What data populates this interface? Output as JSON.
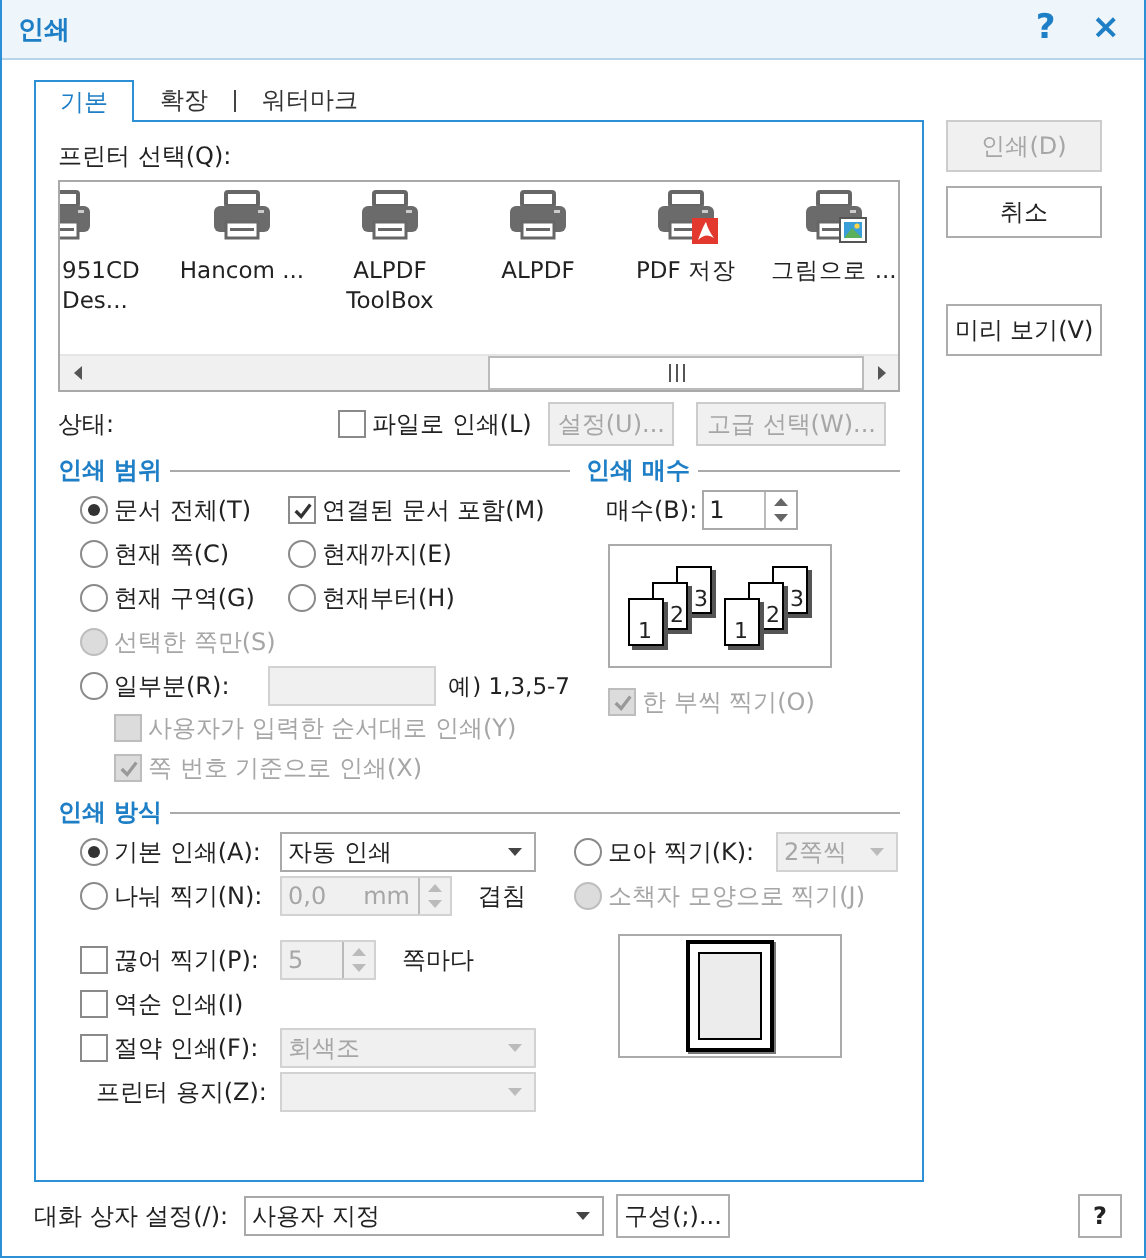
{
  "window": {
    "title": "인쇄",
    "help": "?",
    "close": "×"
  },
  "tabs": [
    {
      "label": "기본",
      "selected": true
    },
    {
      "label": "확장",
      "selected": false
    },
    {
      "label": "워터마크",
      "selected": false
    }
  ],
  "printer_select": {
    "label": "프린터 선택(Q):",
    "printers": [
      {
        "lines": [
          "951CD",
          "Des..."
        ],
        "kind": "plain",
        "selected": false
      },
      {
        "lines": [
          "Hancom ..."
        ],
        "kind": "plain",
        "selected": false
      },
      {
        "lines": [
          "ALPDF",
          "ToolBox"
        ],
        "kind": "plain",
        "selected": false
      },
      {
        "lines": [
          "ALPDF"
        ],
        "kind": "plain",
        "selected": false
      },
      {
        "lines": [
          "PDF 저장"
        ],
        "kind": "pdf",
        "selected": false
      },
      {
        "lines": [
          "그림으로 ..."
        ],
        "kind": "image",
        "selected": false
      }
    ]
  },
  "status_label": "상태:",
  "print_to_file": {
    "label": "파일로 인쇄(L)",
    "checked": false
  },
  "setup_button": {
    "label": "설정(U)...",
    "disabled": true
  },
  "advanced_button": {
    "label": "고급 선택(W)...",
    "disabled": true
  },
  "range": {
    "title": "인쇄 범위",
    "rows": [
      [
        {
          "kind": "radio",
          "label": "문서 전체(T)",
          "selected": true,
          "disabled": false
        },
        {
          "kind": "checkbox",
          "label": "연결된 문서 포함(M)",
          "checked": true,
          "disabled": false
        }
      ],
      [
        {
          "kind": "radio",
          "label": "현재 쪽(C)",
          "selected": false,
          "disabled": false
        },
        {
          "kind": "radio",
          "label": "현재까지(E)",
          "selected": false,
          "disabled": false
        }
      ],
      [
        {
          "kind": "radio",
          "label": "현재 구역(G)",
          "selected": false,
          "disabled": false
        },
        {
          "kind": "radio",
          "label": "현재부터(H)",
          "selected": false,
          "disabled": false
        }
      ],
      [
        {
          "kind": "radio",
          "label": "선택한 쪽만(S)",
          "selected": false,
          "disabled": true
        }
      ]
    ],
    "partial": {
      "label": "일부분(R):",
      "selected": false,
      "field_disabled": true,
      "example": "예) 1,3,5-7"
    },
    "sub_options": [
      {
        "label": "사용자가 입력한 순서대로 인쇄(Y)",
        "checked": false,
        "disabled": true
      },
      {
        "label": "쪽 번호 기준으로 인쇄(X)",
        "checked": true,
        "disabled": true
      }
    ]
  },
  "copies": {
    "title": "인쇄 매수",
    "label": "매수(B):",
    "value": "1",
    "collate_sets": [
      [
        "1",
        "2",
        "3"
      ],
      [
        "1",
        "2",
        "3"
      ]
    ],
    "collate": {
      "label": "한 부씩 찍기(O)",
      "checked": true,
      "disabled": true
    }
  },
  "method": {
    "title": "인쇄 방식",
    "basic": {
      "label": "기본 인쇄(A):",
      "selected": true,
      "value": "자동 인쇄"
    },
    "split": {
      "label": "나눠 찍기(N):",
      "selected": false,
      "value": "0,0",
      "unit": "mm",
      "suffix": "겹침",
      "disabled": true
    },
    "nup": {
      "label": "모아 찍기(K):",
      "selected": false,
      "value": "2쪽씩",
      "disabled": true
    },
    "booklet": {
      "label": "소책자 모양으로 찍기(J)",
      "selected": false,
      "disabled": true
    },
    "checks": [
      {
        "kind": "spin",
        "label": "끊어 찍기(P):",
        "checked": false,
        "value": "5",
        "suffix": "쪽마다",
        "disabled": true
      },
      {
        "kind": "plain",
        "label": "역순 인쇄(I)",
        "checked": false
      },
      {
        "kind": "select",
        "label": "절약 인쇄(F):",
        "checked": false,
        "value": "회색조",
        "disabled": true
      }
    ],
    "paper": {
      "label": "프린터 용지(Z):",
      "disabled": true
    }
  },
  "buttons": [
    {
      "label": "인쇄(D)",
      "disabled": true
    },
    {
      "label": "취소",
      "disabled": false
    },
    {
      "label": "미리 보기(V)",
      "disabled": false
    }
  ],
  "footer": {
    "label": "대화 상자 설정(/):",
    "value": "사용자 지정",
    "configure": "구성(;)...",
    "help": "?"
  }
}
